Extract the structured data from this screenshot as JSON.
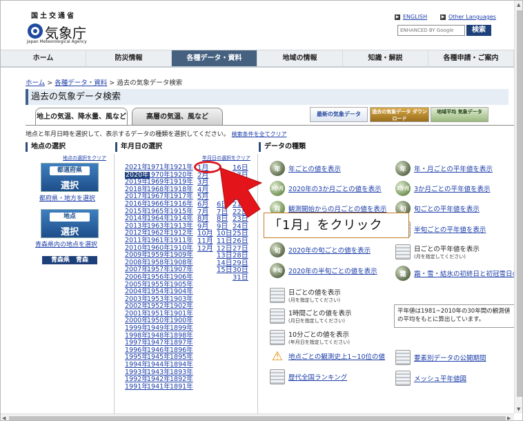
{
  "header": {
    "ministry": "国土交通省",
    "agency": "気象庁",
    "agency_en": "Japan Meteorological Agency",
    "english_link": "ENGLISH",
    "other_languages_link": "Other Languages",
    "search_placeholder": "ENHANCED BY Google",
    "search_button": "検索"
  },
  "nav": [
    "ホーム",
    "防災情報",
    "各種データ・資料",
    "地域の情報",
    "知識・解説",
    "各種申請・ご案内"
  ],
  "breadcrumb": {
    "home": "ホーム",
    "data": "各種データ・資料",
    "current": "過去の気象データ検索",
    "sep": ">"
  },
  "page_title": "過去の気象データ検索",
  "tabs": [
    "地上の気温、降水量、風など",
    "高層の気温、風など"
  ],
  "banners": {
    "latest": "最新の気象データ",
    "download": "過去の気象データ ダウンロード",
    "normal": "地域平均 気象データ"
  },
  "instruction": "地点と年月日時を選択して、表示するデータの種類を選択してください。",
  "clear_all": "検索条件を全てクリア",
  "location": {
    "heading": "地点の選択",
    "clear": "地点の選択をクリア",
    "pref_button": "都道府県",
    "pref_select": "選択",
    "pref_caption": "都府県・地方を選択",
    "point_button": "地点",
    "point_select": "選択",
    "point_caption": "青森県内の地点を選択",
    "selected": "青森県　青森"
  },
  "date": {
    "heading": "年月日の選択",
    "clear": "年月日の選択をクリア",
    "years_col1": [
      "2021年",
      "2020年",
      "2019年",
      "2018年",
      "2017年",
      "2016年",
      "2015年",
      "2014年",
      "2013年",
      "2012年",
      "2011年",
      "2010年",
      "2009年",
      "2008年",
      "2007年",
      "2006年",
      "2005年",
      "2004年",
      "2003年",
      "2002年",
      "2001年",
      "2000年",
      "1999年",
      "1998年",
      "1997年",
      "1996年",
      "1995年",
      "1994年",
      "1993年",
      "1992年",
      "1991年"
    ],
    "years_col2": [
      "1971年",
      "1970年",
      "1969年",
      "1968年",
      "1967年",
      "1966年",
      "1965年",
      "1964年",
      "1963年",
      "1962年",
      "1961年",
      "1960年",
      "1959年",
      "1958年",
      "1957年",
      "1956年",
      "1955年",
      "1954年",
      "1953年",
      "1952年",
      "1951年",
      "1950年",
      "1949年",
      "1948年",
      "1947年",
      "1946年",
      "1945年",
      "1944年",
      "1943年",
      "1942年",
      "1941年"
    ],
    "years_col3": [
      "1921年",
      "1920年",
      "1919年",
      "1918年",
      "1917年",
      "1916年",
      "1915年",
      "1914年",
      "1913年",
      "1912年",
      "1911年",
      "1910年",
      "1909年",
      "1908年",
      "1907年",
      "1906年",
      "1905年",
      "1904年",
      "1903年",
      "1902年",
      "1901年",
      "1900年",
      "1899年",
      "1898年",
      "1897年",
      "1896年",
      "1895年",
      "1894年",
      "1893年",
      "1892年",
      "1891年"
    ],
    "selected_year": "2020年",
    "months": [
      "1月",
      "2月",
      "3月",
      "4月",
      "5月",
      "6月",
      "7月",
      "8月",
      "9月",
      "10月",
      "11月",
      "12月"
    ],
    "days_col1_visible": [
      "",
      "",
      "",
      "",
      "",
      "6日",
      "7日",
      "8日",
      "9日",
      "10日",
      "11日",
      "12日",
      "13日",
      "14日",
      "15日"
    ],
    "days_col2": [
      "16日",
      "17日",
      "18日",
      "19日",
      "20日",
      "21日",
      "22日",
      "23日",
      "24日",
      "25日",
      "26日",
      "27日",
      "28日",
      "29日",
      "30日",
      "31日"
    ],
    "days_partial_top": [
      "日",
      "日",
      "",
      "",
      "",
      "",
      "",
      "",
      "",
      "",
      "",
      "",
      "",
      "",
      "",
      ""
    ]
  },
  "data_types": {
    "heading": "データの種類",
    "left": [
      {
        "icon": "年",
        "label": "年ごとの値を表示"
      },
      {
        "icon": "3か月",
        "label": "2020年の3か月ごとの値を表示"
      },
      {
        "icon": "月",
        "label": "観測開始からの月ごとの値を表示"
      },
      {
        "icon": "月",
        "label": ""
      },
      {
        "icon": "旬",
        "label": "2020年の旬ごとの値を表示"
      },
      {
        "icon": "半旬",
        "label": "2020年の半旬ごとの値を表示"
      },
      {
        "icon": "",
        "label": "日ごとの値を表示",
        "sub": "(月を指定してください)"
      },
      {
        "icon": "",
        "label": "1時間ごとの値を表示",
        "sub": "(月日を指定してください)"
      },
      {
        "icon": "",
        "label": "10分ごとの値を表示",
        "sub": "(年月日を指定してください)"
      },
      {
        "icon": "!",
        "label": "地点ごとの観測史上1~10位の値"
      },
      {
        "icon": "",
        "label": "歴代全国ランキング"
      }
    ],
    "right": [
      {
        "icon": "年",
        "label": "年・月ごとの平年値を表示"
      },
      {
        "icon": "3か月",
        "label": "3か月ごとの平年値を表示"
      },
      {
        "icon": "旬",
        "label": "旬ごとの平年値を表示"
      },
      {
        "icon": "",
        "label": "半旬ごとの平年値を表示"
      },
      {
        "icon": "",
        "label": "日ごとの平年値を表示",
        "sub": "(月を指定してください)"
      },
      {
        "icon": "霜",
        "label": "霜・雪・結氷の初終日と初冠雪日の"
      },
      {
        "icon": "",
        "label": "要素別データの公開期間"
      },
      {
        "icon": "",
        "label": "メッシュ平年値図"
      }
    ],
    "note": "平年値は1981~2010年の30年間の観測値の平均をもとに算出しています。"
  },
  "annotation": {
    "callout": "「1月」をクリック"
  }
}
